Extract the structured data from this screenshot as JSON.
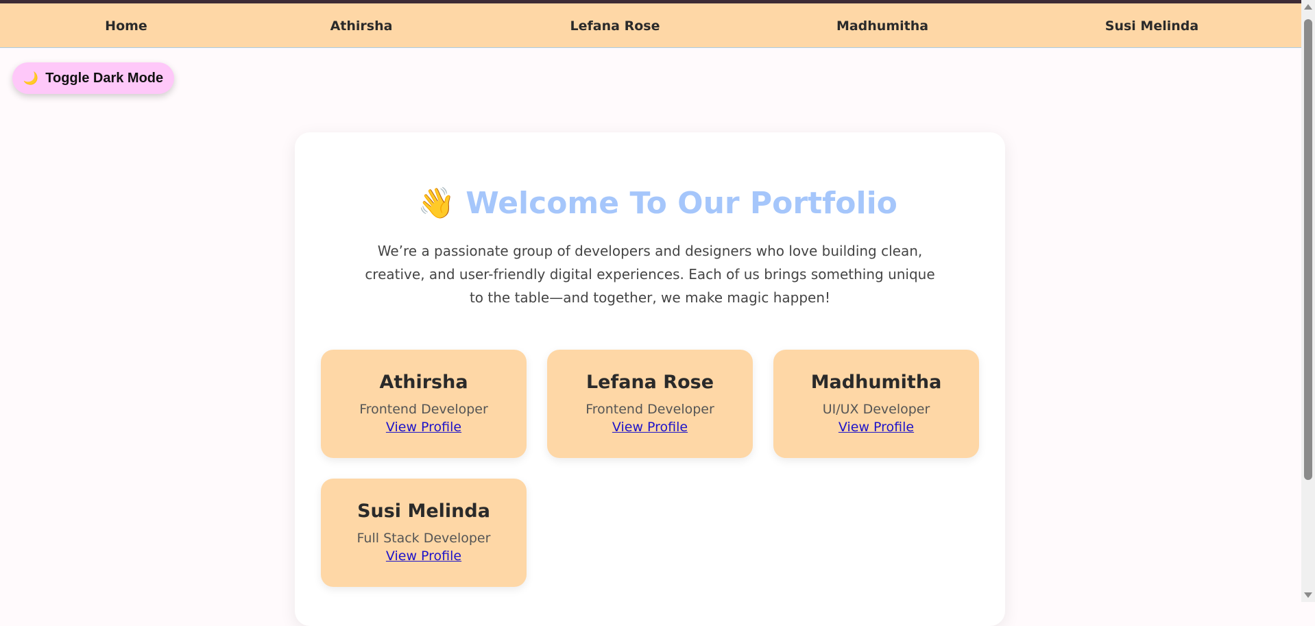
{
  "nav": {
    "items": [
      "Home",
      "Athirsha",
      "Lefana Rose",
      "Madhumitha",
      "Susi Melinda"
    ]
  },
  "toggle": {
    "icon": "moon-icon",
    "label": "Toggle Dark Mode"
  },
  "hero": {
    "wave": "👋",
    "title": "Welcome To Our Portfolio",
    "description": "We’re a passionate group of developers and designers who love building clean, creative, and user-friendly digital experiences. Each of us brings something unique to the table—and together, we make magic happen!"
  },
  "members": [
    {
      "name": "Athirsha",
      "role": "Frontend Developer",
      "link": "View Profile"
    },
    {
      "name": "Lefana Rose",
      "role": "Frontend Developer",
      "link": "View Profile"
    },
    {
      "name": "Madhumitha",
      "role": "UI/UX Developer",
      "link": "View Profile"
    },
    {
      "name": "Susi Melinda",
      "role": "Full Stack Developer",
      "link": "View Profile"
    }
  ],
  "colors": {
    "navbar": "#fed7a6",
    "toggle": "#fec8f9",
    "title": "#a5c6fb",
    "card": "#fed7a6",
    "link": "#1d13c9"
  }
}
